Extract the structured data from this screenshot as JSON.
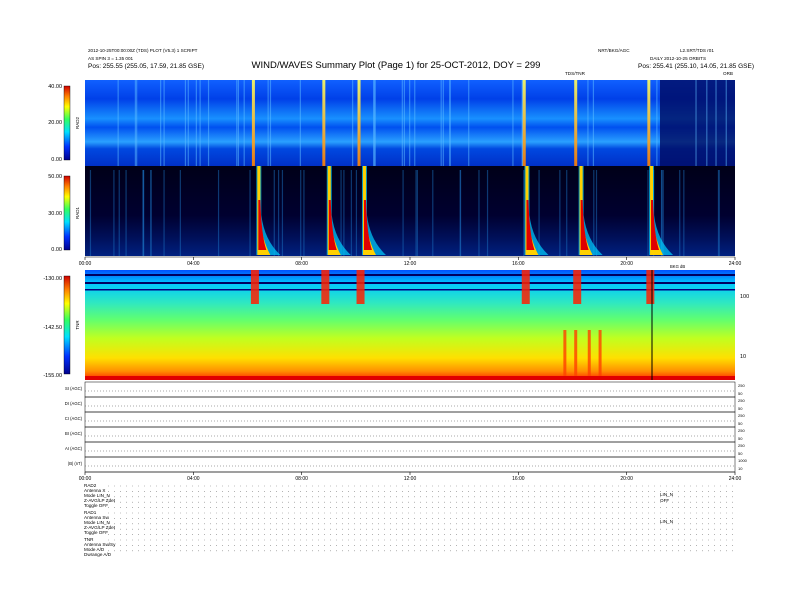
{
  "header": {
    "title": "WIND/WAVES Summary Plot (Page 1) for 25-OCT-2012, DOY = 299",
    "left_line1": "2012-10-25T00:00:00Z (TDS) PLOT (V5.3) 1 SCRIPT",
    "left_line2": "AS SPIN 3 = 1.35 001",
    "left_pos": "Pos:   255.55 (255.05, 17.59, 21.85 GSE)",
    "right_top_left": "NRT/BKG/AGC",
    "right_top_right": "L2.SRT/TDS r01",
    "right_line2": "DAILY 2012-10-25 ORBITS",
    "right_pos": "Pos:   255.41 (255.10, 14.05, 21.85 GSE)",
    "tds_label": "TDS/TNR",
    "corner_mark": "ORB"
  },
  "panels": {
    "rad2": {
      "label": "RAD2",
      "ticks": [
        "40.00",
        "20.00",
        "0.00"
      ]
    },
    "rad1": {
      "label": "RAD1",
      "ticks": [
        "50.00",
        "30.00",
        "0.00"
      ]
    },
    "tnr": {
      "label": "TNR",
      "ticks": [
        "-130.00",
        "-142.50",
        "-155.00"
      ],
      "right_ticks": [
        "100",
        "10"
      ],
      "top_note": "BKG dB"
    }
  },
  "time_axis": [
    "00:00",
    "04:00",
    "08:00",
    "12:00",
    "16:00",
    "20:00",
    "24:00"
  ],
  "agc_rows": [
    {
      "label": "SI (AGC)",
      "right": [
        "250",
        "50"
      ]
    },
    {
      "label": "DI (AGC)",
      "right": [
        "250",
        "50"
      ]
    },
    {
      "label": "CI (AGC)",
      "right": [
        "250",
        "50"
      ]
    },
    {
      "label": "BI (AGC)",
      "right": [
        "250",
        "50"
      ]
    },
    {
      "label": "AI (AGC)",
      "right": [
        "250",
        "50"
      ]
    },
    {
      "label": "|B| (nT)",
      "right": [
        "1000",
        "10"
      ]
    }
  ],
  "footer": {
    "rad2_block": [
      "RAD2",
      "Antenna   X",
      "Mode   LIN_N",
      "Z-AVG/LP  Zdet",
      "Toggle     OFF"
    ],
    "rad1_block": [
      "RAD1",
      "Antenna   Sw",
      "Mode   LIN_N",
      "Z-AVG/LP  Zdet",
      "Toggle     OFF"
    ],
    "tnr_block": [
      "TNR",
      "Antenna   Sw/Sy",
      "Mode      A/D",
      "Dwrange    A/D"
    ],
    "right_notes": [
      "LIN_N",
      "OFF",
      "LIN_N"
    ]
  },
  "chart_data": [
    {
      "type": "heatmap",
      "name": "RAD2",
      "ylabel": "RAD2",
      "ylim": [
        0,
        40
      ],
      "xlim": [
        "00:00",
        "24:00"
      ],
      "colorbar": [
        "blue",
        "cyan",
        "green",
        "yellow",
        "red"
      ],
      "bursts_hours": [
        6.2,
        8.8,
        10.1,
        16.2,
        18.1,
        20.8
      ]
    },
    {
      "type": "heatmap",
      "name": "RAD1",
      "ylabel": "RAD1",
      "ylim": [
        0,
        50
      ],
      "xlim": [
        "00:00",
        "24:00"
      ],
      "bursts_hours": [
        6.4,
        9.0,
        10.3,
        16.3,
        18.3,
        20.9
      ]
    },
    {
      "type": "heatmap",
      "name": "TNR",
      "ylabel": "TNR",
      "ylim": [
        -155,
        -130
      ],
      "xlim": [
        "00:00",
        "24:00"
      ]
    }
  ]
}
